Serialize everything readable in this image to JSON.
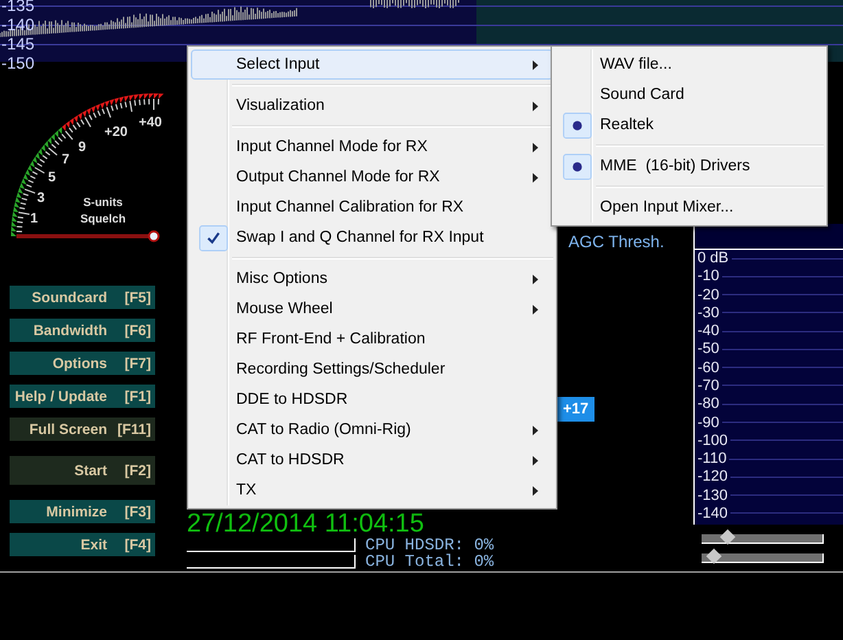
{
  "spectrum": {
    "scale": [
      "-135",
      "-140",
      "-145",
      "-150"
    ]
  },
  "s_meter": {
    "labels": [
      "1",
      "3",
      "5",
      "7",
      "9",
      "+20",
      "+40"
    ],
    "title": "S-units",
    "subtitle": "Squelch",
    "squelch": {
      "level": 1
    }
  },
  "buttons": [
    {
      "label": "Soundcard",
      "key": "[F5]",
      "dimmed": false
    },
    {
      "label": "Bandwidth",
      "key": "[F6]",
      "dimmed": false
    },
    {
      "label": "Options",
      "key": "[F7]",
      "dimmed": false
    },
    {
      "label": "Help / Update",
      "key": "[F1]",
      "dimmed": false
    },
    {
      "label": "Full Screen",
      "key": "[F11]",
      "dimmed": true
    },
    {
      "label": "Start",
      "key": "[F2]",
      "dimmed": true
    },
    {
      "label": "Minimize",
      "key": "[F3]",
      "dimmed": false
    },
    {
      "label": "Exit",
      "key": "[F4]",
      "dimmed": false
    }
  ],
  "agc_label": "AGC Thresh.",
  "badge": "+17",
  "clock": "27/12/2014 11:04:15",
  "cpu": [
    {
      "label": "CPU HDSDR: 0%"
    },
    {
      "label": "CPU Total: 0%"
    }
  ],
  "level_display": {
    "scale": [
      "0 dB",
      "-10",
      "-20",
      "-30",
      "-40",
      "-50",
      "-60",
      "-70",
      "-80",
      "-90",
      "-100",
      "-110",
      "-120",
      "-130",
      "-140"
    ]
  },
  "sliders": [
    {
      "level": 0.22
    },
    {
      "level": 0.1
    }
  ],
  "menu": {
    "items": [
      {
        "kind": "item",
        "label": "Select Input",
        "submenu": true,
        "selected": true,
        "checked": false
      },
      {
        "kind": "separator"
      },
      {
        "kind": "item",
        "label": "Visualization",
        "submenu": true,
        "selected": false,
        "checked": false
      },
      {
        "kind": "separator"
      },
      {
        "kind": "item",
        "label": "Input Channel Mode for RX",
        "submenu": true,
        "selected": false,
        "checked": false
      },
      {
        "kind": "item",
        "label": "Output Channel Mode for RX",
        "submenu": true,
        "selected": false,
        "checked": false
      },
      {
        "kind": "item",
        "label": "Input Channel Calibration for RX",
        "submenu": false,
        "selected": false,
        "checked": false
      },
      {
        "kind": "item",
        "label": "Swap I and Q Channel for RX Input",
        "submenu": false,
        "selected": false,
        "checked": true
      },
      {
        "kind": "separator"
      },
      {
        "kind": "item",
        "label": "Misc Options",
        "submenu": true,
        "selected": false,
        "checked": false
      },
      {
        "kind": "item",
        "label": "Mouse Wheel",
        "submenu": true,
        "selected": false,
        "checked": false
      },
      {
        "kind": "item",
        "label": "RF Front-End + Calibration",
        "submenu": false,
        "selected": false,
        "checked": false
      },
      {
        "kind": "item",
        "label": "Recording Settings/Scheduler",
        "submenu": false,
        "selected": false,
        "checked": false
      },
      {
        "kind": "item",
        "label": "DDE to HDSDR",
        "submenu": false,
        "selected": false,
        "checked": false
      },
      {
        "kind": "item",
        "label": "CAT to Radio (Omni-Rig)",
        "submenu": true,
        "selected": false,
        "checked": false
      },
      {
        "kind": "item",
        "label": "CAT to HDSDR",
        "submenu": true,
        "selected": false,
        "checked": false
      },
      {
        "kind": "item",
        "label": "TX",
        "submenu": true,
        "selected": false,
        "checked": false
      }
    ]
  },
  "submenu": {
    "items": [
      {
        "kind": "item",
        "label": "WAV file..."
      },
      {
        "kind": "item",
        "label": "Sound Card"
      },
      {
        "kind": "radio",
        "label": "Realtek",
        "checked": true
      },
      {
        "kind": "separator"
      },
      {
        "kind": "radio",
        "label": "MME  (16-bit) Drivers",
        "checked": true
      },
      {
        "kind": "separator"
      },
      {
        "kind": "item",
        "label": "Open Input Mixer..."
      }
    ]
  }
}
